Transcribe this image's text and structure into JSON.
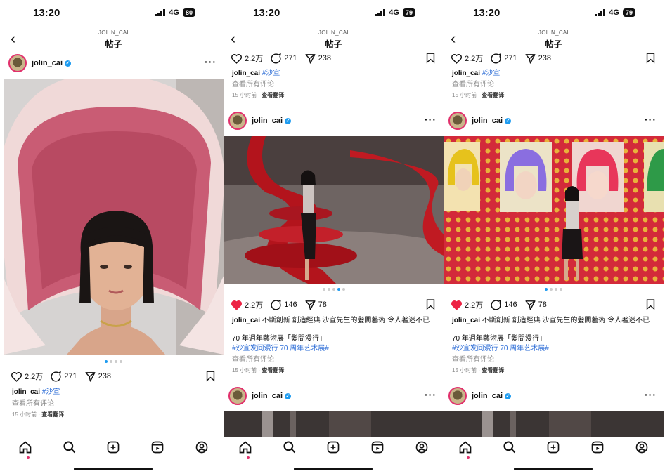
{
  "status": {
    "time": "13:20",
    "network": "4G",
    "battery_1": "80",
    "battery_2": "79",
    "battery_3": "79"
  },
  "header": {
    "username": "JOLIN_CAI",
    "title": "帖子",
    "back": "‹"
  },
  "post": {
    "username": "jolin_cai",
    "more": "···",
    "view_comments": "查看所有评论",
    "time_ago": "15 小时前",
    "translate": "查看翻译"
  },
  "first_post": {
    "likes": "2.2万",
    "comments": "271",
    "shares": "238",
    "tag": "#沙宣"
  },
  "second_post": {
    "likes": "2.2万",
    "comments": "146",
    "shares": "78",
    "caption": "不斷創新 創造經典 沙宣先生的髮間藝術 令人著迷不已",
    "line2": "70 年週年藝術展「髮間漫行」",
    "hashtags": "#沙宣发间漫行 70 周年艺术展#"
  },
  "separator": " · ",
  "colors": {
    "accent": "#1d9bf0",
    "like": "#ed2344",
    "story_ring": "#e1306c"
  },
  "tabs": [
    "home-icon",
    "search-icon",
    "create-icon",
    "reels-icon",
    "profile-icon"
  ]
}
